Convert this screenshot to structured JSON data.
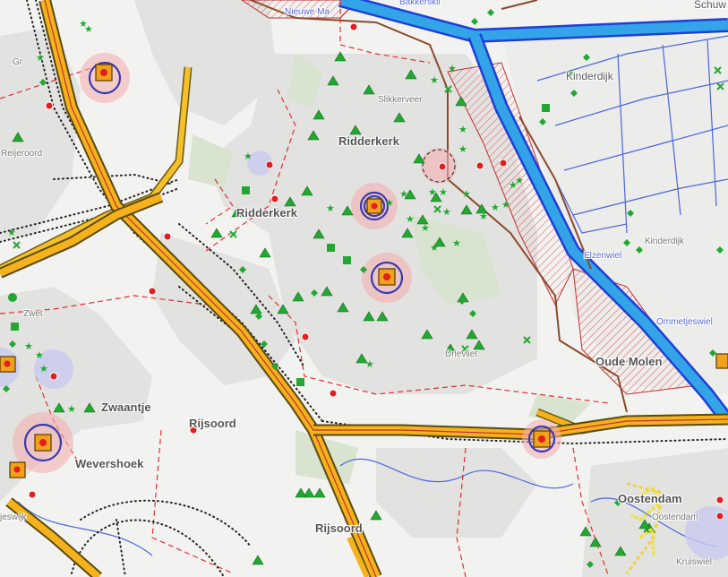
{
  "map": {
    "labels": {
      "nieuwe_maas": "Nieuwe Ma",
      "bakkerskil": "Bakkerskil",
      "schuwacht": "Schuw",
      "kinderdijk_top": "Kinderdijk",
      "kinderdijk_mid": "Kinderdijk",
      "gr": "Gr",
      "reijeroord": "Reijeroord",
      "slikkerveer": "Slikkerveer",
      "ridderkerk_main": "Ridderkerk",
      "ridderkerk_west": "Ridderkerk",
      "zwet": "Zwet",
      "elzenwiel": "Elzenwiel",
      "ommetjeswiel": "Ommetjeswiel",
      "drievliet": "Drievliet",
      "oude_molen": "Oude Molen",
      "zwaantje": "Zwaantje",
      "rijsoord_north": "Rijsoord",
      "wevershoek": "Wevershoek",
      "oostendam": "Oostendam",
      "oostendam_small": "Oostendam",
      "rijsoord_south": "Rijsoord",
      "jeswijk": "jeswijk",
      "kruiswiel": "Kruiswiel"
    },
    "colors": {
      "water_main": "#33a4e8",
      "water_dark": "#1f3fd6",
      "highway_fill": "#f5b21c",
      "highway_edge": "#5a4a10",
      "regional_road": "#f2d13a",
      "dyke": "#8b4a2c",
      "boundary": "#e03030",
      "poi_triangle": "#22a832",
      "poi_dot": "#e21e1e",
      "hazard_ring": "#3a3ab0",
      "hazard_halo": "#f4b0b0",
      "hazard_square": "#f2a11a"
    },
    "icons": [
      "triangle-marker-icon",
      "star-marker-icon",
      "diamond-marker-icon",
      "cross-marker-icon",
      "red-dot-marker-icon",
      "hazard-site-icon"
    ]
  }
}
